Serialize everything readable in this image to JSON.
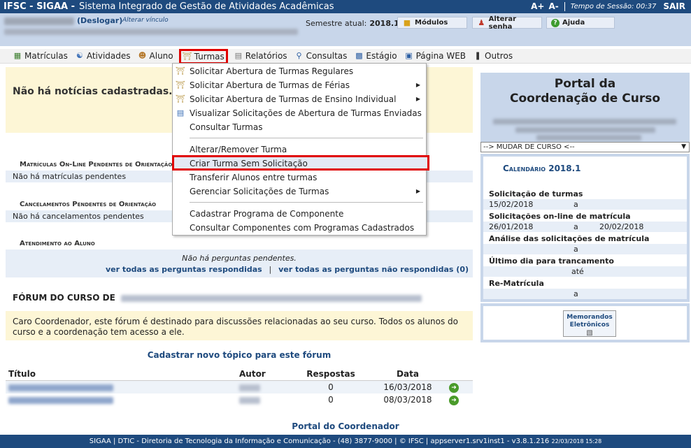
{
  "topbar": {
    "brand": "IFSC - SIGAA -",
    "system_name": "Sistema Integrado de Gestão de Atividades Acadêmicas",
    "font_increase": "A+",
    "font_decrease": "A-",
    "session_label": "Tempo de Sessão: 00:37",
    "logout": "SAIR"
  },
  "userband": {
    "deslogar": "(Deslogar)",
    "alterar_vinculo": "Alterar vínculo",
    "semestre_label": "Semestre atual:",
    "semestre_value": "2018.1",
    "modulos": "Módulos",
    "alterar_senha": "Alterar senha",
    "ajuda": "Ajuda"
  },
  "menu": {
    "items": [
      "Matrículas",
      "Atividades",
      "Aluno",
      "Turmas",
      "Relatórios",
      "Consultas",
      "Estágio",
      "Página WEB",
      "Outros"
    ]
  },
  "dropdown": {
    "items": [
      "Solicitar Abertura de Turmas Regulares",
      "Solicitar Abertura de Turmas de Férias",
      "Solicitar Abertura de Turmas de Ensino Individual",
      "Visualizar Solicitações de Abertura de Turmas Enviadas",
      "Consultar Turmas",
      "Alterar/Remover Turma",
      "Criar Turma Sem Solicitação",
      "Transferir Alunos entre turmas",
      "Gerenciar Solicitações de Turmas",
      "Cadastrar Programa de Componente",
      "Consultar Componentes com Programas Cadastrados"
    ]
  },
  "content": {
    "no_news": "Não há notícias cadastradas.",
    "matriculas_title": "Matrículas On-Line Pendentes de Orientação",
    "matriculas_value": "Não há matrículas pendentes",
    "cancelamentos_title": "Cancelamentos Pendentes de Orientação",
    "cancelamentos_value": "Não há cancelamentos pendentes",
    "atendimento_title": "Atendimento ao Aluno",
    "atendimento_none": "Não há perguntas pendentes.",
    "link_respondidas": "ver todas as perguntas respondidas",
    "link_separator": "|",
    "link_nao_respondidas": "ver todas as perguntas não respondidas (0)"
  },
  "forum": {
    "title": "FÓRUM DO CURSO DE",
    "message": "Caro Coordenador, este fórum é destinado para discussões relacionadas ao seu curso. Todos os alunos do curso e a coordenação tem acesso a ele.",
    "new_topic": "Cadastrar novo tópico para este fórum",
    "columns": [
      "Título",
      "Autor",
      "Respostas",
      "Data"
    ],
    "rows": [
      {
        "respostas": "0",
        "data": "16/03/2018"
      },
      {
        "respostas": "0",
        "data": "08/03/2018"
      }
    ]
  },
  "right": {
    "portal_title_1": "Portal da",
    "portal_title_2": "Coordenação de Curso",
    "mudar_curso": "--> MUDAR DE CURSO <--",
    "cal_prefix": "Calendário",
    "cal_year": "2018.1",
    "cal": [
      {
        "label": "Solicitação de turmas",
        "start": "15/02/2018",
        "sep": "a",
        "end": ""
      },
      {
        "label": "Solicitações on-line de matrícula",
        "start": "26/01/2018",
        "sep": "a",
        "end": "20/02/2018"
      },
      {
        "label": "Análise das solicitações de matrícula",
        "start": "",
        "sep": "a",
        "end": ""
      },
      {
        "label": "Último dia para trancamento",
        "start": "",
        "sep": "até",
        "end": ""
      },
      {
        "label": "Re-Matrícula",
        "start": "",
        "sep": "a",
        "end": ""
      }
    ],
    "memorandos_1": "Memorandos",
    "memorandos_2": "Eletrônicos"
  },
  "footer": {
    "portal_link": "Portal do Coordenador",
    "text": "SIGAA | DTIC - Diretoria de Tecnologia da Informação e Comunicação - (48) 3877-9000 | © IFSC | appserver1.srv1inst1 - v3.8.1.216",
    "timestamp": "22/03/2018 15:28"
  },
  "colors": {
    "primary": "#1e4a7e",
    "band": "#c8d6ea",
    "highlight": "#e00000",
    "news_bg": "#fdf6d6"
  }
}
